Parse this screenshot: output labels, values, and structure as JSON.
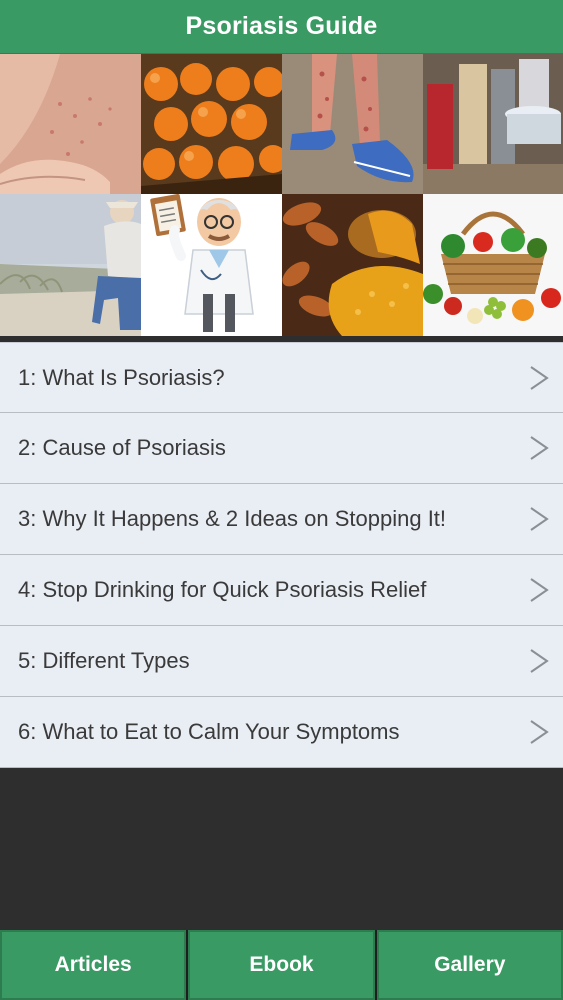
{
  "header": {
    "title": "Psoriasis Guide"
  },
  "banner": {
    "tiles": [
      {
        "icon": "skin-rash-photo"
      },
      {
        "icon": "oranges-photo"
      },
      {
        "icon": "rash-legs-photo"
      },
      {
        "icon": "pantry-shelf-photo"
      },
      {
        "icon": "person-on-beach-photo"
      },
      {
        "icon": "doctor-cartoon"
      },
      {
        "icon": "turmeric-photo"
      },
      {
        "icon": "vegetable-basket-photo"
      }
    ]
  },
  "articles": [
    {
      "label": "1: What Is Psoriasis?"
    },
    {
      "label": "2: Cause of Psoriasis"
    },
    {
      "label": "3: Why It Happens & 2 Ideas on Stopping It!"
    },
    {
      "label": "4: Stop Drinking for Quick Psoriasis Relief"
    },
    {
      "label": "5: Different Types"
    },
    {
      "label": "6: What to Eat to Calm Your Symptoms"
    }
  ],
  "tabbar": {
    "tabs": [
      {
        "label": "Articles"
      },
      {
        "label": "Ebook"
      },
      {
        "label": "Gallery"
      }
    ]
  },
  "colors": {
    "brand": "#3a9a64",
    "list_bg": "#e9edf4",
    "dark_bg": "#2e2e2e"
  }
}
